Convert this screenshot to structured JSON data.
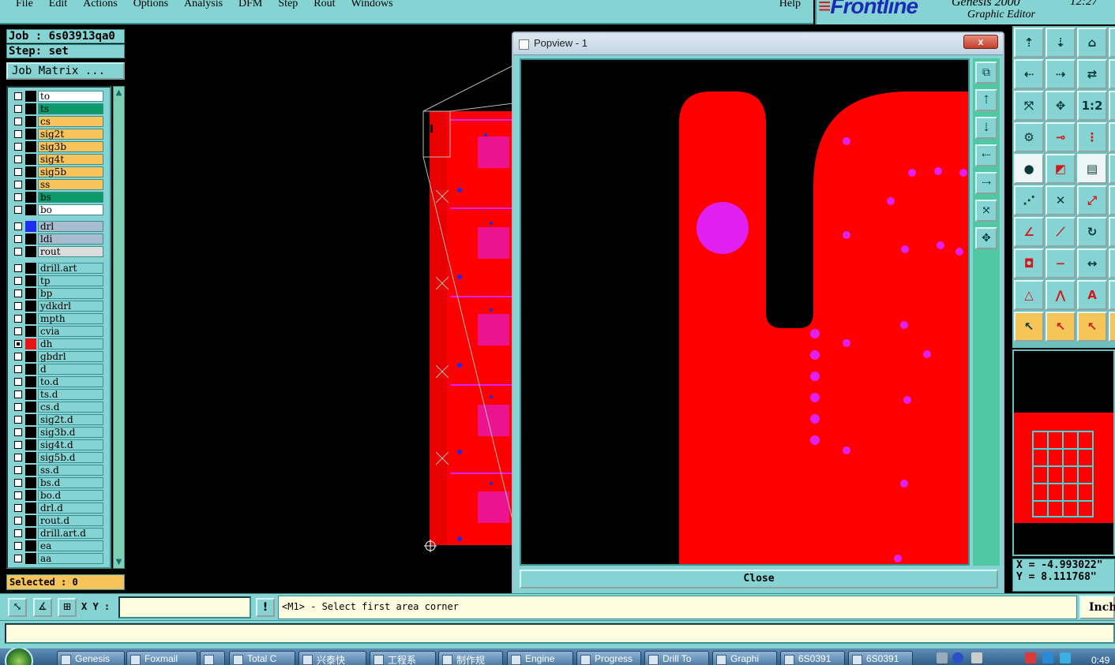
{
  "menu": [
    "File",
    "Edit",
    "Actions",
    "Options",
    "Analysis",
    "DFM",
    "Step",
    "Rout",
    "Windows"
  ],
  "help": "Help",
  "brand": {
    "logo": "Frontline",
    "version": "Genesis 2000",
    "subtitle": "Graphic Editor",
    "clock": "12:27"
  },
  "job": {
    "job_label": "Job : 6s03913qa0",
    "step_label": "Step: set",
    "matrix_button": "Job Matrix ..."
  },
  "layers": [
    {
      "name": "to",
      "color": "#ffffff",
      "checked": false,
      "swatch": "#000000"
    },
    {
      "name": "ts",
      "color": "#0d9a6a",
      "checked": false,
      "swatch": "#000000"
    },
    {
      "name": "cs",
      "color": "#f8c45a",
      "checked": false,
      "swatch": "#000000"
    },
    {
      "name": "sig2t",
      "color": "#f8c45a",
      "checked": false,
      "swatch": "#000000"
    },
    {
      "name": "sig3b",
      "color": "#f8c45a",
      "checked": false,
      "swatch": "#000000"
    },
    {
      "name": "sig4t",
      "color": "#f8c45a",
      "checked": false,
      "swatch": "#000000"
    },
    {
      "name": "sig5b",
      "color": "#f8c45a",
      "checked": false,
      "swatch": "#000000"
    },
    {
      "name": "ss",
      "color": "#f8c45a",
      "checked": false,
      "swatch": "#000000"
    },
    {
      "name": "bs",
      "color": "#0d9a6a",
      "checked": false,
      "swatch": "#000000"
    },
    {
      "name": "bo",
      "color": "#ffffff",
      "checked": false,
      "swatch": "#000000"
    },
    {
      "name": "drl",
      "color": "#a9bccf",
      "checked": false,
      "swatch": "#1f2ff0"
    },
    {
      "name": "ldi",
      "color": "#a9bccf",
      "checked": false,
      "swatch": "#000000"
    },
    {
      "name": "rout",
      "color": "#dcdcdc",
      "checked": false,
      "swatch": "#000000"
    },
    {
      "name": "drill.art",
      "color": "#85d3d3",
      "checked": false,
      "swatch": "#000000"
    },
    {
      "name": "tp",
      "color": "#85d3d3",
      "checked": false,
      "swatch": "#000000"
    },
    {
      "name": "bp",
      "color": "#85d3d3",
      "checked": false,
      "swatch": "#000000"
    },
    {
      "name": "ydkdrl",
      "color": "#85d3d3",
      "checked": false,
      "swatch": "#000000"
    },
    {
      "name": "mpth",
      "color": "#85d3d3",
      "checked": false,
      "swatch": "#000000"
    },
    {
      "name": "cvia",
      "color": "#85d3d3",
      "checked": false,
      "swatch": "#000000"
    },
    {
      "name": "dh",
      "color": "#85d3d3",
      "checked": true,
      "swatch": "#e61414"
    },
    {
      "name": "gbdrl",
      "color": "#85d3d3",
      "checked": false,
      "swatch": "#000000"
    },
    {
      "name": "d",
      "color": "#85d3d3",
      "checked": false,
      "swatch": "#000000"
    },
    {
      "name": "to.d",
      "color": "#85d3d3",
      "checked": false,
      "swatch": "#000000"
    },
    {
      "name": "ts.d",
      "color": "#85d3d3",
      "checked": false,
      "swatch": "#000000"
    },
    {
      "name": "cs.d",
      "color": "#85d3d3",
      "checked": false,
      "swatch": "#000000"
    },
    {
      "name": "sig2t.d",
      "color": "#85d3d3",
      "checked": false,
      "swatch": "#000000"
    },
    {
      "name": "sig3b.d",
      "color": "#85d3d3",
      "checked": false,
      "swatch": "#000000"
    },
    {
      "name": "sig4t.d",
      "color": "#85d3d3",
      "checked": false,
      "swatch": "#000000"
    },
    {
      "name": "sig5b.d",
      "color": "#85d3d3",
      "checked": false,
      "swatch": "#000000"
    },
    {
      "name": "ss.d",
      "color": "#85d3d3",
      "checked": false,
      "swatch": "#000000"
    },
    {
      "name": "bs.d",
      "color": "#85d3d3",
      "checked": false,
      "swatch": "#000000"
    },
    {
      "name": "bo.d",
      "color": "#85d3d3",
      "checked": false,
      "swatch": "#000000"
    },
    {
      "name": "drl.d",
      "color": "#85d3d3",
      "checked": false,
      "swatch": "#000000"
    },
    {
      "name": "rout.d",
      "color": "#85d3d3",
      "checked": false,
      "swatch": "#000000"
    },
    {
      "name": "drill.art.d",
      "color": "#85d3d3",
      "checked": false,
      "swatch": "#000000"
    },
    {
      "name": "ea",
      "color": "#85d3d3",
      "checked": false,
      "swatch": "#000000"
    },
    {
      "name": "aa",
      "color": "#85d3d3",
      "checked": false,
      "swatch": "#000000"
    }
  ],
  "selected": "Selected : 0",
  "popview": {
    "title": "Popview - 1",
    "close_x": "x",
    "close_button": "Close"
  },
  "coords": {
    "x": "X = -4.993022\"",
    "y": "Y =  8.111768\""
  },
  "command": {
    "xy_label": "X Y :",
    "xy_value": "",
    "bang": "!",
    "message": "<M1> - Select first area corner",
    "units": "Inch"
  },
  "taskbar": [
    {
      "label": "Genesis"
    },
    {
      "label": "Foxmail"
    },
    {
      "label": ""
    },
    {
      "label": "Total C"
    },
    {
      "label": "兴泰快"
    },
    {
      "label": "工程系"
    },
    {
      "label": "制作规"
    },
    {
      "label": "Engine"
    },
    {
      "label": "Progress"
    },
    {
      "label": "Drill To"
    },
    {
      "label": "Graphi"
    },
    {
      "label": "6S0391"
    },
    {
      "label": "6S0391"
    }
  ],
  "tray_clock": "0:49",
  "colors": {
    "panel": "#85d3d3",
    "copper": "#ff0000",
    "pad": "#e020f0",
    "blue_pad": "#1a2cf0",
    "highlight": "#f8c45a"
  }
}
